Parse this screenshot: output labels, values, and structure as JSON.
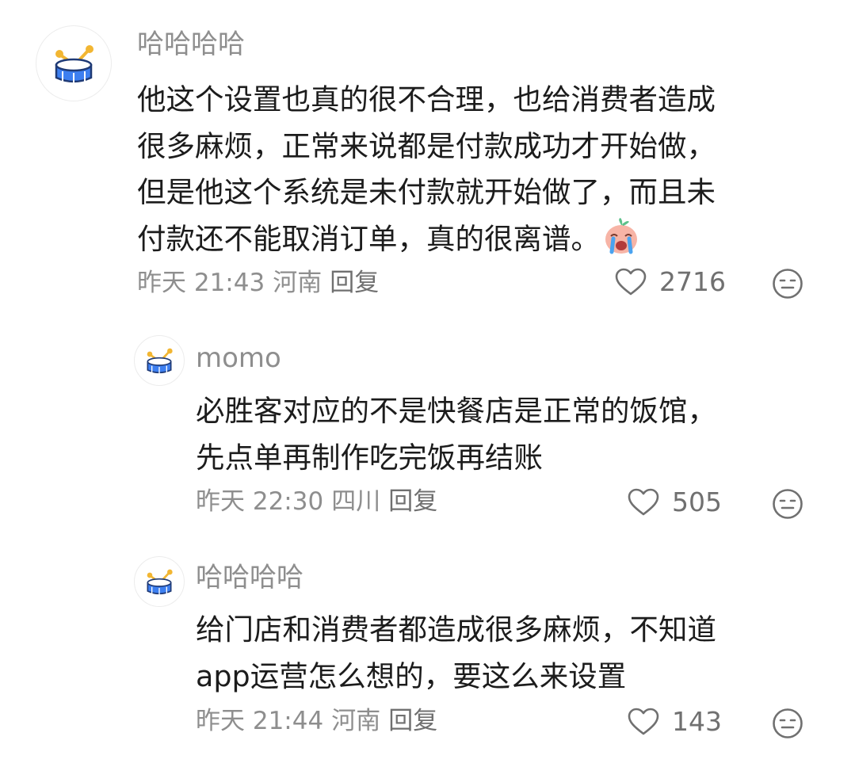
{
  "comments": [
    {
      "username": "哈哈哈哈",
      "text": "他这个设置也真的很不合理，也给消费者造成\n很多麻烦，正常来说都是付款成功才开始做，\n但是他这个系统是未付款就开始做了，而且未\n付款还不能取消订单，真的很离谱。",
      "emoji": "crying-emoji",
      "time": "昨天 21:43",
      "location": "河南",
      "reply_label": "回复",
      "likes": "2716"
    },
    {
      "username": "momo",
      "text": "必胜客对应的不是快餐店是正常的饭馆，\n先点单再制作吃完饭再结账",
      "time": "昨天 22:30",
      "location": "四川",
      "reply_label": "回复",
      "likes": "505"
    },
    {
      "username": "哈哈哈哈",
      "text": "给门店和消费者都造成很多麻烦，不知道\napp运营怎么想的，要这么来设置",
      "time": "昨天 21:44",
      "location": "河南",
      "reply_label": "回复",
      "likes": "143"
    }
  ],
  "icons": {
    "avatar": "drum-avatar-icon",
    "like": "heart-outline-icon",
    "dislike": "unhappy-face-icon"
  },
  "colors": {
    "drum_blue": "#3d7ff0",
    "drum_stick": "#f2b632",
    "secondary_text": "#8e8e8e"
  }
}
